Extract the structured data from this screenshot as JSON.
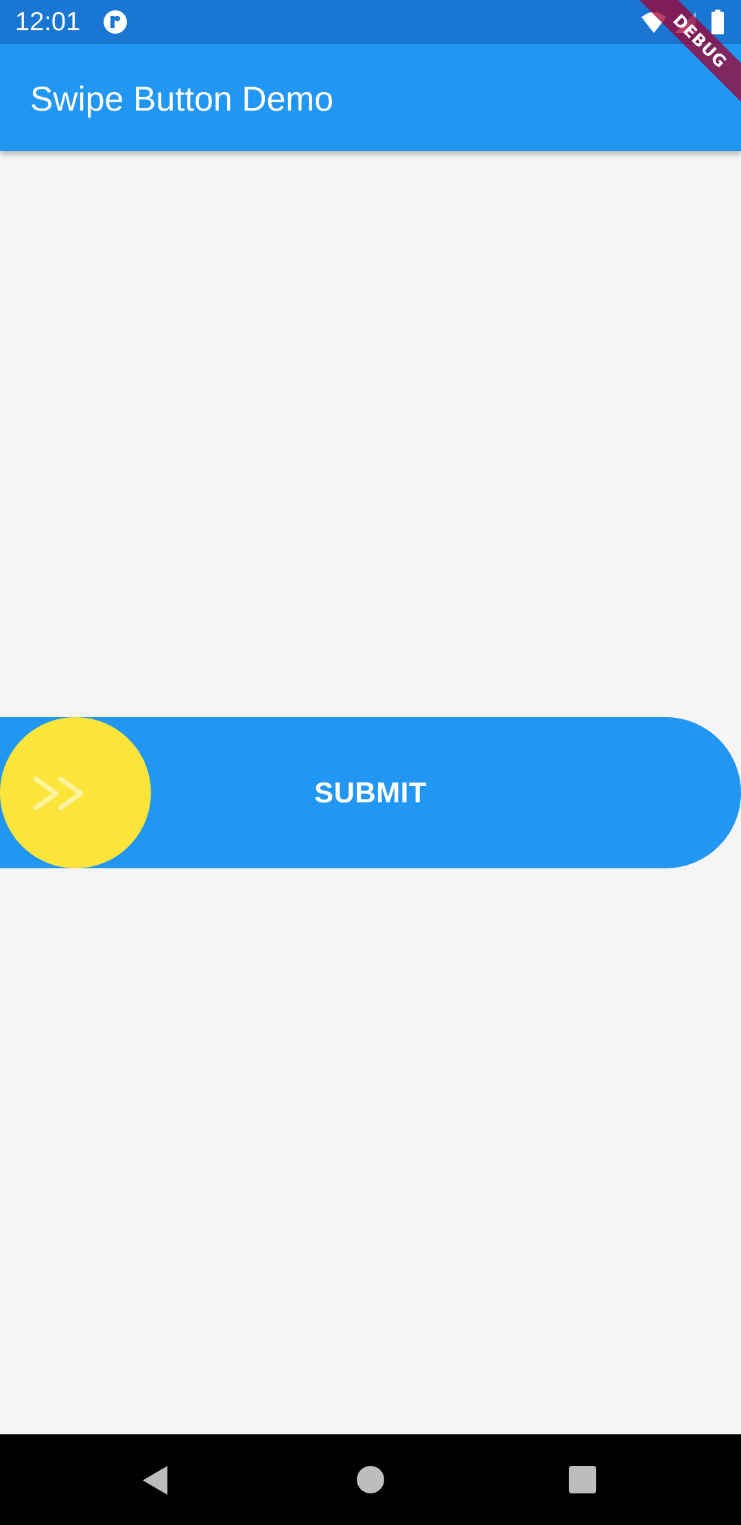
{
  "status_bar": {
    "time": "12:01",
    "icons": [
      "notification-icon",
      "wifi-icon",
      "signal-icon",
      "battery-icon"
    ]
  },
  "app_bar": {
    "title": "Swipe Button Demo"
  },
  "debug_banner": {
    "label": "DEBUG"
  },
  "swipe_button": {
    "label": "SUBMIT",
    "thumb_icon": "double-chevron-right-icon",
    "progress": 0
  },
  "nav_bar": {
    "icons": [
      "back-icon",
      "home-icon",
      "recents-icon"
    ]
  },
  "colors": {
    "status_bar": "#1976d2",
    "app_bar": "#2196f3",
    "background": "#f6f5f5",
    "swipe_track": "#2196f3",
    "swipe_thumb": "#fbe53b",
    "nav_bar": "#000000"
  }
}
